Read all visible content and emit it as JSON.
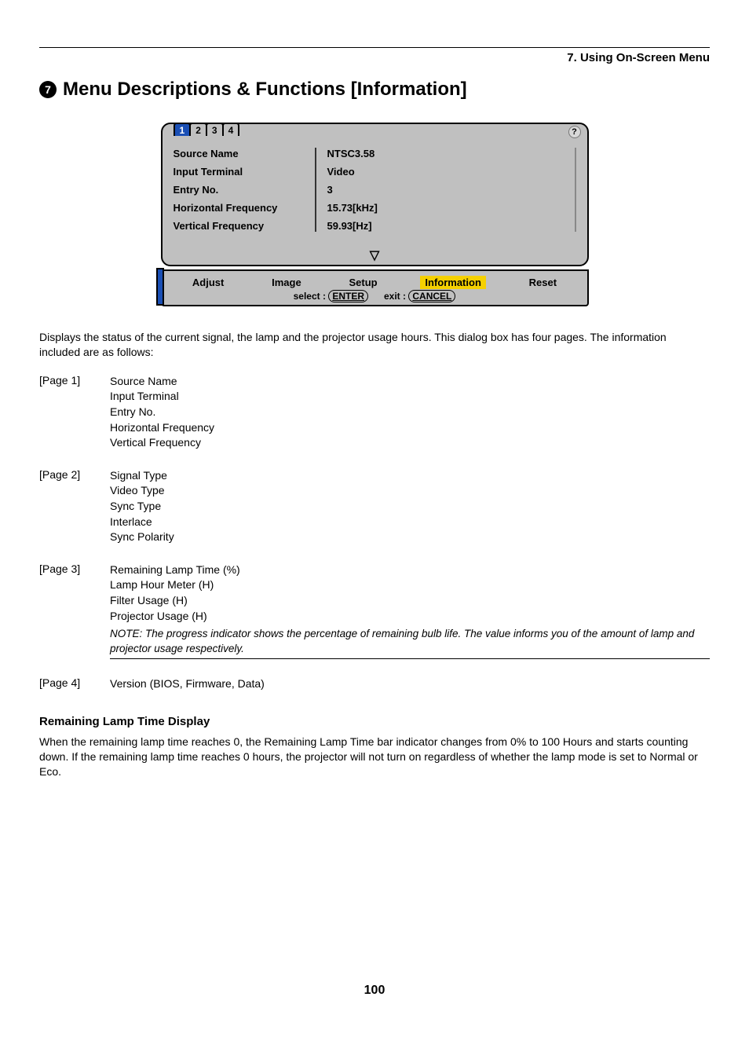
{
  "header": {
    "chapter": "7. Using On-Screen Menu"
  },
  "section": {
    "number": "7",
    "title": "Menu Descriptions & Functions [Information]"
  },
  "osd": {
    "tabs": [
      "1",
      "2",
      "3",
      "4"
    ],
    "active_tab": "1",
    "help_icon": "?",
    "rows": [
      {
        "label": "Source Name",
        "value": "NTSC3.58"
      },
      {
        "label": "Input Terminal",
        "value": "Video"
      },
      {
        "label": "Entry No.",
        "value": "3"
      },
      {
        "label": "Horizontal Frequency",
        "value": "15.73[kHz]"
      },
      {
        "label": "Vertical Frequency",
        "value": "59.93[Hz]"
      }
    ],
    "arrow": "▽",
    "menus": [
      "Adjust",
      "Image",
      "Setup",
      "Information",
      "Reset"
    ],
    "highlight": "Information",
    "hint_select_label": "select :",
    "hint_select_key": "ENTER",
    "hint_exit_label": "exit :",
    "hint_exit_key": "CANCEL"
  },
  "intro_para": "Displays the status of the current signal, the lamp and the projector usage hours. This dialog box has four pages. The information included are as follows:",
  "pages": [
    {
      "label": "[Page 1]",
      "items": [
        "Source Name",
        "Input Terminal",
        "Entry No.",
        "Horizontal Frequency",
        "Vertical Frequency"
      ]
    },
    {
      "label": "[Page 2]",
      "items": [
        "Signal Type",
        "Video Type",
        "Sync Type",
        "Interlace",
        "Sync Polarity"
      ]
    },
    {
      "label": "[Page 3]",
      "items": [
        "Remaining Lamp Time (%)",
        "Lamp Hour Meter (H)",
        "Filter Usage (H)",
        "Projector Usage (H)"
      ],
      "note": "NOTE: The progress indicator shows the percentage of remaining bulb life. The value informs you of the amount of lamp and projector usage respectively."
    },
    {
      "label": "[Page 4]",
      "items": [
        "Version (BIOS, Firmware, Data)"
      ]
    }
  ],
  "subhead": "Remaining Lamp Time Display",
  "sub_para": "When the remaining lamp time reaches 0, the Remaining Lamp Time bar indicator changes from 0% to 100 Hours and starts counting down. If the remaining lamp time reaches 0 hours, the projector will not turn on regardless of whether the lamp mode is set to Normal or Eco.",
  "page_number": "100"
}
